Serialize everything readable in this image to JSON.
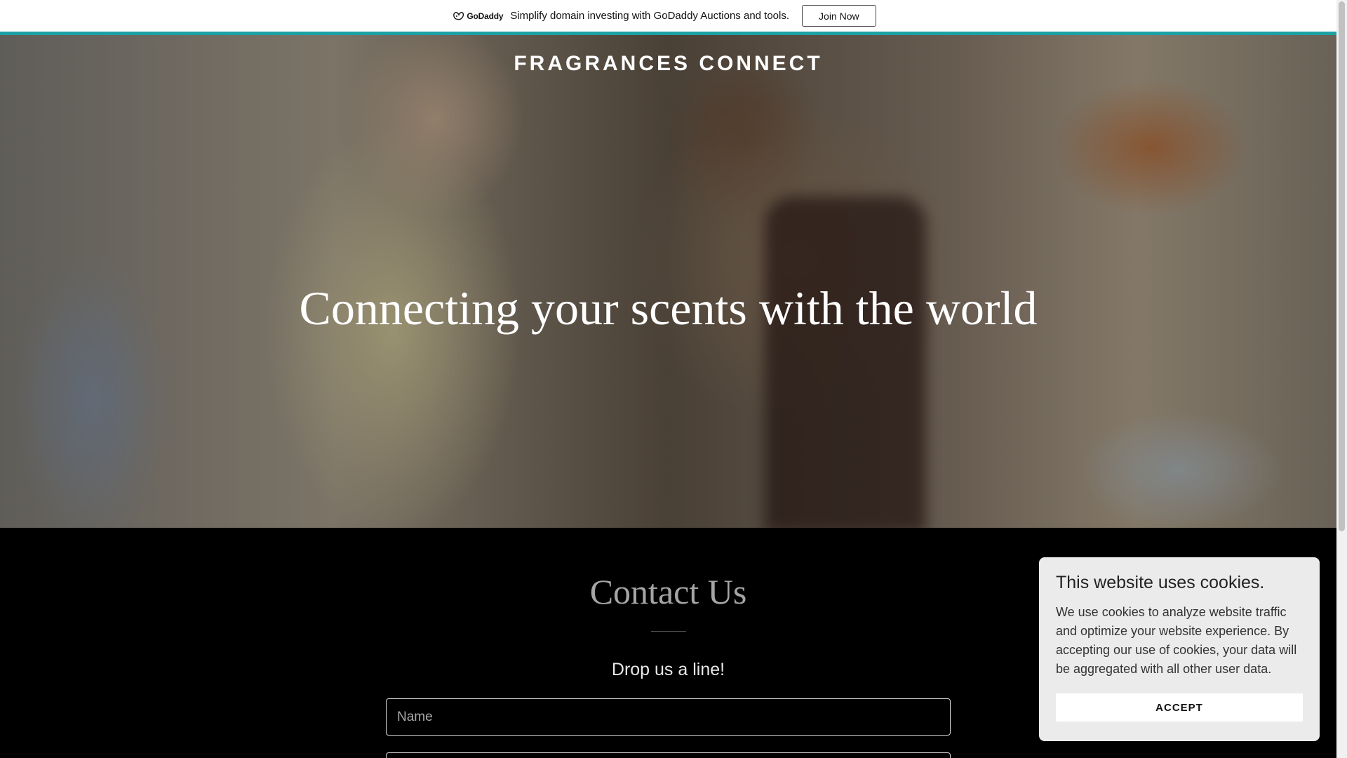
{
  "promo_bar": {
    "logo_text": "GoDaddy",
    "message": "Simplify domain investing with GoDaddy Auctions and tools.",
    "join_label": "Join Now",
    "accent_color": "#1ba1a4"
  },
  "hero": {
    "site_title": "FRAGRANCES CONNECT",
    "heading": "Connecting your scents with the world"
  },
  "contact": {
    "title": "Contact Us",
    "subtitle": "Drop us a line!",
    "name_placeholder": "Name"
  },
  "cookie_banner": {
    "title": "This website uses cookies.",
    "body": "We use cookies to analyze website traffic and optimize your website experience. By accepting our use of cookies, your data will be aggregated with all other user data.",
    "accept_label": "ACCEPT"
  }
}
